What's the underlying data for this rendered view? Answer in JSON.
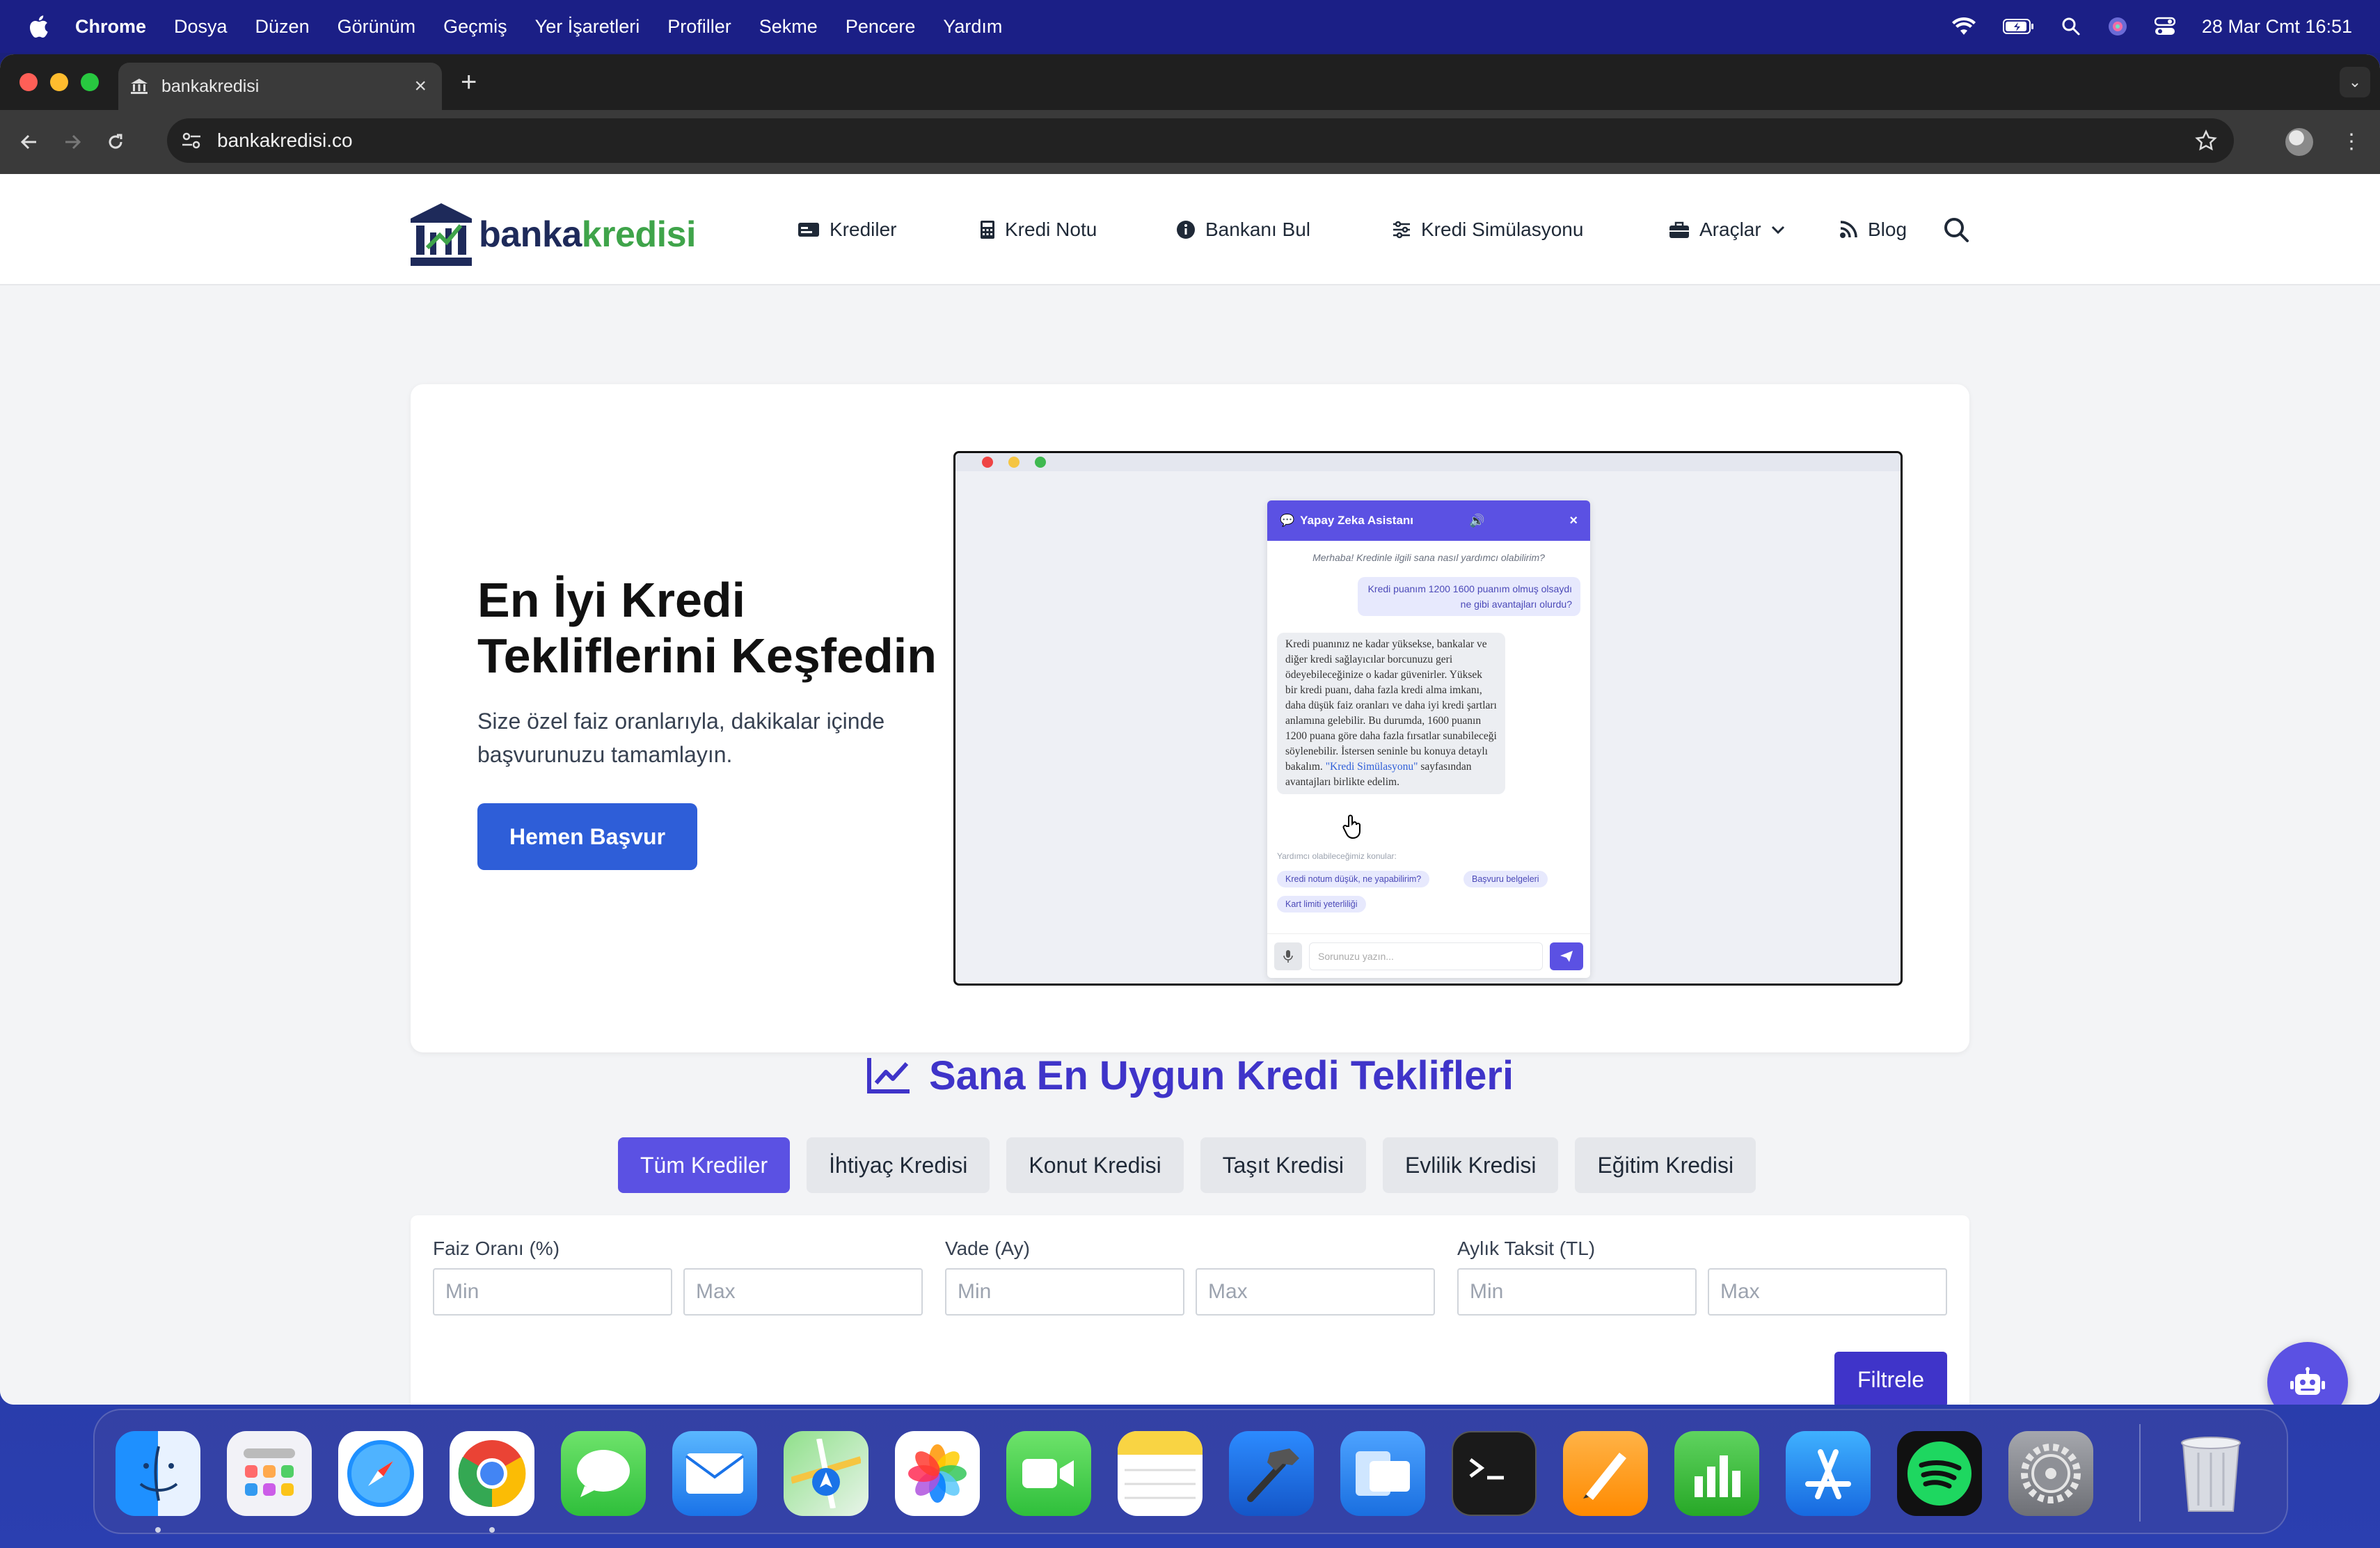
{
  "menubar": {
    "app": "Chrome",
    "items": [
      "Dosya",
      "Düzen",
      "Görünüm",
      "Geçmiş",
      "Yer İşaretleri",
      "Profiller",
      "Sekme",
      "Pencere",
      "Yardım"
    ],
    "clock": "28 Mar Cmt  16:51"
  },
  "browser": {
    "tab_title": "bankakredisi",
    "url": "bankakredisi.co"
  },
  "site": {
    "logo": {
      "part1": "banka",
      "part2": "kredisi"
    },
    "nav": [
      "Krediler",
      "Kredi Notu",
      "Bankanı Bul",
      "Kredi Simülasyonu",
      "Araçlar",
      "Blog"
    ]
  },
  "hero": {
    "title_line1": "En İyi Kredi",
    "title_line2": "Tekliflerini Keşfedin",
    "subtitle": "Size özel faiz oranlarıyla, dakikalar içinde başvurunuzu tamamlayın.",
    "cta": "Hemen Başvur"
  },
  "chat_demo": {
    "title": "Yapay Zeka Asistanı",
    "greeting": "Merhaba! Kredinle ilgili sana nasıl yardımcı olabilirim?",
    "user_message": "Kredi puanım 1200 1600 puanım olmuş olsaydı ne gibi avantajları olurdu?",
    "bot_message": "Kredi puanınız ne kadar yüksekse, bankalar ve diğer kredi sağlayıcılar borcunuzu geri ödeyebileceğinize o kadar güvenirler. Yüksek bir kredi puanı, daha fazla kredi alma imkanı, daha düşük faiz oranları ve daha iyi kredi şartları anlamına gelebilir. Bu durumda, 1600 puanın 1200 puana göre daha fazla fırsatlar sunabileceği söylenebilir. İstersen seninle bu konuya detaylı bakalım.",
    "bot_link": "\"Kredi Simülasyonu\"",
    "bot_tail": " sayfasından avantajları birlikte edelim.",
    "topics_label": "Yardımcı olabileceğimiz konular:",
    "chips": [
      "Kredi notum düşük, ne yapabilirim?",
      "Başvuru belgeleri",
      "Kart limiti yeterliliği"
    ],
    "input_placeholder": "Sorunuzu yazın..."
  },
  "offers": {
    "title": "Sana En Uygun Kredi Teklifleri",
    "tabs": [
      "Tüm Krediler",
      "İhtiyaç Kredisi",
      "Konut Kredisi",
      "Taşıt Kredisi",
      "Evlilik Kredisi",
      "Eğitim Kredisi"
    ],
    "active_tab": "Tüm Krediler",
    "filters": [
      {
        "label": "Faiz Oranı (%)",
        "min": "Min",
        "max": "Max"
      },
      {
        "label": "Vade (Ay)",
        "min": "Min",
        "max": "Max"
      },
      {
        "label": "Aylık Taksit (TL)",
        "min": "Min",
        "max": "Max"
      }
    ],
    "filter_button": "Filtrele"
  },
  "colors": {
    "brand_primary": "#5b51e3",
    "brand_dark": "#3f34c9",
    "cta_blue": "#2e5ed8",
    "logo_navy": "#1e2a5a",
    "logo_green": "#3fa44a"
  },
  "dock": [
    "finder-icon",
    "launchpad-icon",
    "safari-icon",
    "chrome-icon",
    "messages-icon",
    "mail-icon",
    "maps-icon",
    "photos-icon",
    "facetime-icon",
    "notes-icon",
    "xcode-icon",
    "preview-icon",
    "terminal-icon",
    "pages-icon",
    "numbers-icon",
    "app-store-icon",
    "spotify-icon",
    "system-settings-icon",
    "trash-icon"
  ]
}
